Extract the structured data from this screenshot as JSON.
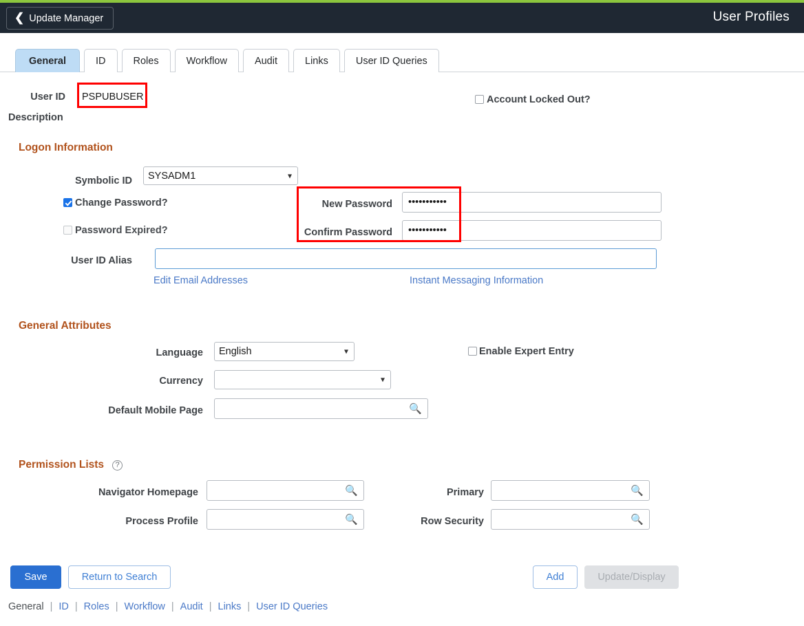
{
  "theme": {
    "accent_green": "#8cc63e",
    "header_bg": "#1f2833",
    "active_tab_bg": "#bedcf5",
    "section_heading": "#b1521c",
    "link_blue": "#4a79c7",
    "primary_button": "#2a6fd1",
    "annotation_red": "#ff0000"
  },
  "header": {
    "back_label": "Update Manager",
    "back_icon": "chevron-left-icon",
    "title": "User Profiles"
  },
  "tabs": [
    {
      "label": "General",
      "active": true
    },
    {
      "label": "ID",
      "active": false
    },
    {
      "label": "Roles",
      "active": false
    },
    {
      "label": "Workflow",
      "active": false
    },
    {
      "label": "Audit",
      "active": false
    },
    {
      "label": "Links",
      "active": false
    },
    {
      "label": "User ID Queries",
      "active": false
    }
  ],
  "identity": {
    "user_id_label": "User ID",
    "user_id_value": "PSPUBUSER",
    "description_label": "Description",
    "description_value": "",
    "account_locked_label": "Account Locked Out?",
    "account_locked_checked": false
  },
  "logon": {
    "heading": "Logon Information",
    "symbolic_id_label": "Symbolic ID",
    "symbolic_id_value": "SYSADM1",
    "symbolic_id_options": [
      "SYSADM1"
    ],
    "change_password_label": "Change Password?",
    "change_password_checked": true,
    "password_expired_label": "Password Expired?",
    "password_expired_checked": false,
    "new_password_label": "New Password",
    "new_password_value": "•••••••••••",
    "confirm_password_label": "Confirm Password",
    "confirm_password_value": "•••••••••••",
    "user_id_alias_label": "User ID Alias",
    "user_id_alias_value": "",
    "edit_email_link": "Edit Email Addresses",
    "instant_messaging_link": "Instant Messaging Information"
  },
  "general_attributes": {
    "heading": "General Attributes",
    "language_label": "Language",
    "language_value": "English",
    "language_options": [
      "English"
    ],
    "currency_label": "Currency",
    "currency_value": "",
    "currency_options": [
      ""
    ],
    "default_mobile_page_label": "Default Mobile Page",
    "default_mobile_page_value": "",
    "default_mobile_page_icon": "search-icon",
    "enable_expert_entry_label": "Enable Expert Entry",
    "enable_expert_entry_checked": false
  },
  "permission_lists": {
    "heading": "Permission Lists",
    "help_icon": "help-circle-icon",
    "navigator_homepage_label": "Navigator Homepage",
    "navigator_homepage_value": "",
    "process_profile_label": "Process Profile",
    "process_profile_value": "",
    "primary_label": "Primary",
    "primary_value": "",
    "row_security_label": "Row Security",
    "row_security_value": "",
    "lookup_icon": "search-icon"
  },
  "actions": {
    "save_label": "Save",
    "return_to_search_label": "Return to Search",
    "add_label": "Add",
    "update_display_label": "Update/Display",
    "update_display_disabled": true
  },
  "bottom_links": [
    {
      "label": "General",
      "current": true
    },
    {
      "label": "ID",
      "current": false
    },
    {
      "label": "Roles",
      "current": false
    },
    {
      "label": "Workflow",
      "current": false
    },
    {
      "label": "Audit",
      "current": false
    },
    {
      "label": "Links",
      "current": false
    },
    {
      "label": "User ID Queries",
      "current": false
    }
  ],
  "annotations": [
    {
      "name": "user-id-highlight",
      "target": "user_id_value"
    },
    {
      "name": "password-fields-highlight",
      "target": "new_password_and_confirm_password"
    }
  ]
}
